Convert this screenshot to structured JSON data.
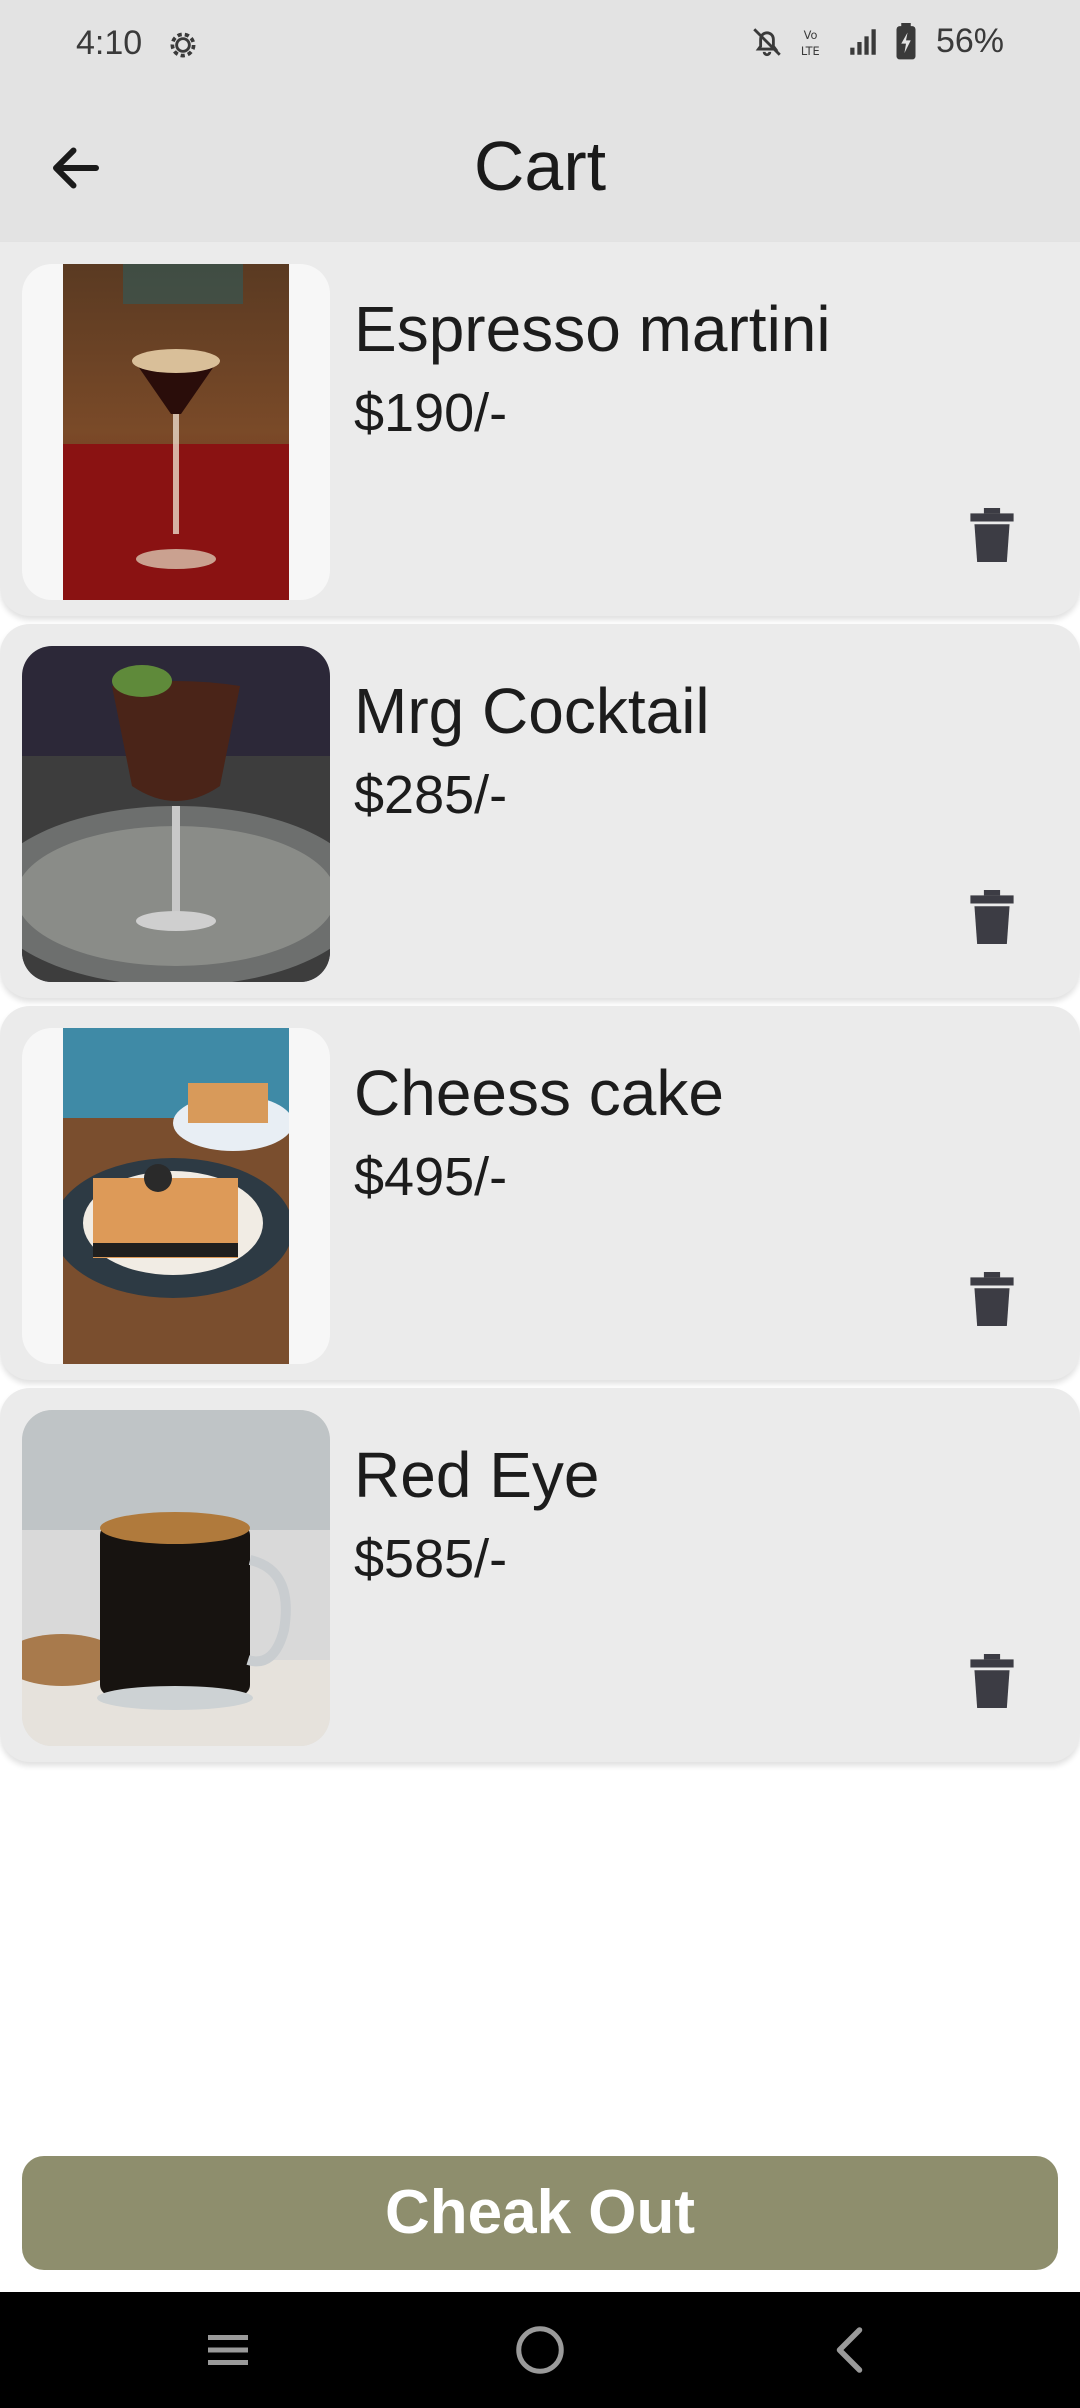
{
  "status_bar": {
    "time": "4:10",
    "battery": "56%",
    "icons": [
      "gear-icon",
      "bell-off-icon",
      "volte-icon",
      "signal-icon",
      "battery-icon"
    ]
  },
  "app_bar": {
    "title": "Cart",
    "back_icon": "arrow-left-icon"
  },
  "cart": {
    "items": [
      {
        "name": "Espresso martini",
        "price": "$190/-",
        "image": "espresso-martini-image",
        "delete_icon": "trash-icon"
      },
      {
        "name": "Mrg Cocktail",
        "price": "$285/-",
        "image": "mrg-cocktail-image",
        "delete_icon": "trash-icon"
      },
      {
        "name": "Cheess cake",
        "price": "$495/-",
        "image": "cheesecake-image",
        "delete_icon": "trash-icon"
      },
      {
        "name": "Red Eye",
        "price": "$585/-",
        "image": "red-eye-coffee-image",
        "delete_icon": "trash-icon"
      }
    ]
  },
  "checkout": {
    "label": "Cheak Out"
  },
  "nav_bar": {
    "icons": [
      "recents-icon",
      "home-icon",
      "back-icon"
    ]
  },
  "colors": {
    "bar_background": "#e3e3e3",
    "card_background": "#ebebeb",
    "checkout_button": "#8e8e6d",
    "nav_background": "#000000"
  }
}
